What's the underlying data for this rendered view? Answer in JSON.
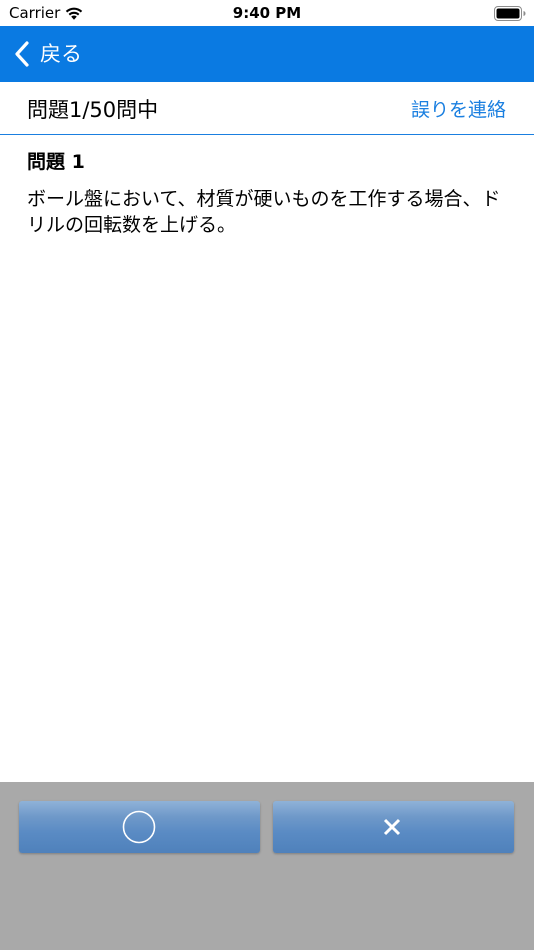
{
  "status_bar": {
    "carrier": "Carrier",
    "time": "9:40 PM",
    "icons": [
      "wifi-icon",
      "battery-icon"
    ]
  },
  "nav_bar": {
    "back_label": "戻る",
    "color": "#0a7ae2"
  },
  "header": {
    "progress": "問題1/50問中",
    "report_link": "誤りを連絡",
    "accent_color": "#1a7fe0"
  },
  "question": {
    "number_label": "問題 1",
    "text": "ボール盤において、材質が硬いものを工作する場合、ドリルの回転数を上げる。"
  },
  "answers": {
    "true_icon": "circle-icon",
    "false_icon": "cross-icon",
    "panel_color": "#a9a9a9",
    "button_color": "#5a8bc4"
  }
}
